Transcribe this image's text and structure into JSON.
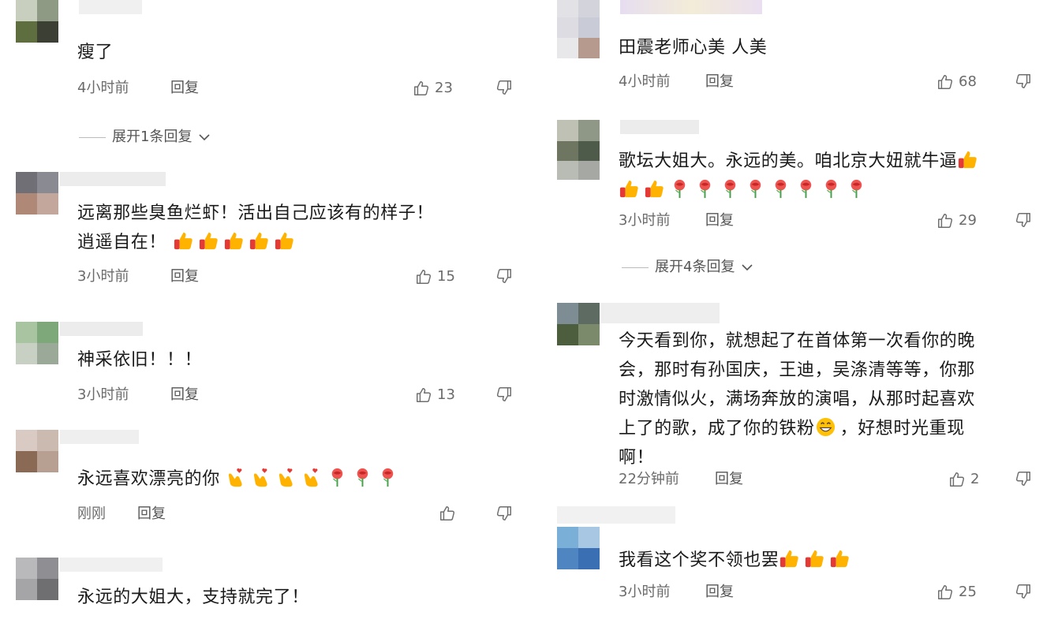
{
  "left_column": [
    {
      "text": "瘦了",
      "time": "4小时前",
      "reply": "回复",
      "likes": "23",
      "expand": "展开1条回复"
    },
    {
      "text": "远离那些臭鱼烂虾！活出自己应该有的样子！\n逍遥自在！",
      "time": "3小时前",
      "reply": "回复",
      "likes": "15"
    },
    {
      "text": "神采依旧！！！",
      "time": "3小时前",
      "reply": "回复",
      "likes": "13"
    },
    {
      "text": "永远喜欢漂亮的你",
      "time": "刚刚",
      "reply": "回复",
      "likes": ""
    },
    {
      "text": "永远的大姐大，支持就完了！"
    }
  ],
  "right_column": [
    {
      "text": "田震老师心美 人美",
      "time": "4小时前",
      "reply": "回复",
      "likes": "68"
    },
    {
      "text": "歌坛大姐大。永远的美。咱北京大妞就牛逼",
      "time": "3小时前",
      "reply": "回复",
      "likes": "29",
      "expand": "展开4条回复"
    },
    {
      "text": "今天看到你，就想起了在首体第一次看你的晚\n会，那时有孙国庆，王迪，吴涤清等等，你那\n时激情似火，满场奔放的演唱，从那时起喜欢\n上了的歌，成了你的铁粉",
      "text_tail": "，好想时光重现\n啊！",
      "time": "22分钟前",
      "reply": "回复",
      "likes": "2"
    },
    {
      "text": "我看这个奖不领也罢",
      "time": "3小时前",
      "reply": "回复",
      "likes": "25"
    }
  ],
  "colors": {
    "text": "#1a1a1a",
    "meta": "#6b6b6b",
    "accent_like": "#707070"
  },
  "icons": {
    "like": "thumbs-up-icon",
    "dislike": "thumbs-down-icon",
    "expand": "chevron-down-icon",
    "emoji_thumb": "thumbs-up-emoji",
    "emoji_rose": "rose-emoji",
    "emoji_heart": "finger-heart-emoji",
    "emoji_grin": "grin-emoji"
  }
}
